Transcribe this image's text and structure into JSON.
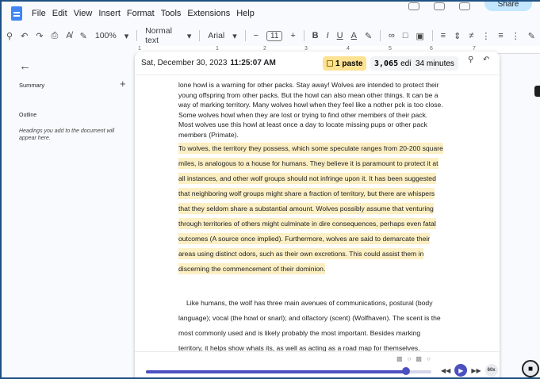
{
  "menubar": {
    "items": [
      "File",
      "Edit",
      "View",
      "Insert",
      "Format",
      "Tools",
      "Extensions",
      "Help"
    ],
    "share_label": "Share"
  },
  "toolbar": {
    "zoom": "100%",
    "style": "Normal text",
    "font": "Arial",
    "font_size": "11"
  },
  "ruler": {
    "marks": [
      "1",
      "1",
      "2",
      "3",
      "4",
      "5",
      "6",
      "7"
    ]
  },
  "outline_panel": {
    "summary_label": "Summary",
    "outline_label": "Outline",
    "outline_hint": "Headings you add to the document will appear here."
  },
  "playback": {
    "date": "Sat, December 30, 2023",
    "time": "11:25:07 AM",
    "paste_count": "1 paste",
    "edits_count": "3,065",
    "edits_label": "edits",
    "duration": "34 minutes",
    "progress_fraction": 0.91,
    "speed": "60x"
  },
  "document": {
    "p1_lines": [
      "lone howl is a warning for other packs. Stay away! Wolves are intended to protect their",
      "young offspring from other packs. But the howl can also mean other things. It can be a",
      "way of marking territory. Many wolves howl when they feel like a nother pck is too close.",
      "Some wolves howl when they are lost or trying to find other members of their pack.",
      "Most wolves use this howl at least once a day to locate missing pups or other pack",
      "members (Primate)."
    ],
    "pasted_lines": [
      "To wolves, the territory they possess, which some speculate ranges from 20-200 square",
      "miles, is analogous to a house for humans. They believe it is paramount to protect it at",
      "all instances, and other wolf groups should not infringe upon it. It has been suggested",
      "that neighboring wolf groups might share a fraction of territory, but there are whispers",
      "that they seldom share a substantial amount. Wolves possibly assume that venturing",
      "through territories of others might culminate in dire consequences, perhaps even fatal",
      "outcomes (A source once implied). Furthermore, wolves are said to demarcate their",
      "areas using distinct odors, such as their own excretions. This could assist them in",
      "discerning the commencement of their dominion."
    ],
    "p3_lines": [
      "Like humans, the wolf has three main avenues of communications, postural (body",
      "language); vocal (the howl or snarl); and olfactory (scent) (Wolfhaven). The scent is the",
      "most commonly used and is likely probably the most important. Besides marking",
      "territory, it helps show whats its, as well as acting as a road map for themselves."
    ]
  },
  "colors": {
    "highlight": "#fcefc3",
    "paste_badge": "#fde293",
    "progress": "#4b4fc0"
  }
}
